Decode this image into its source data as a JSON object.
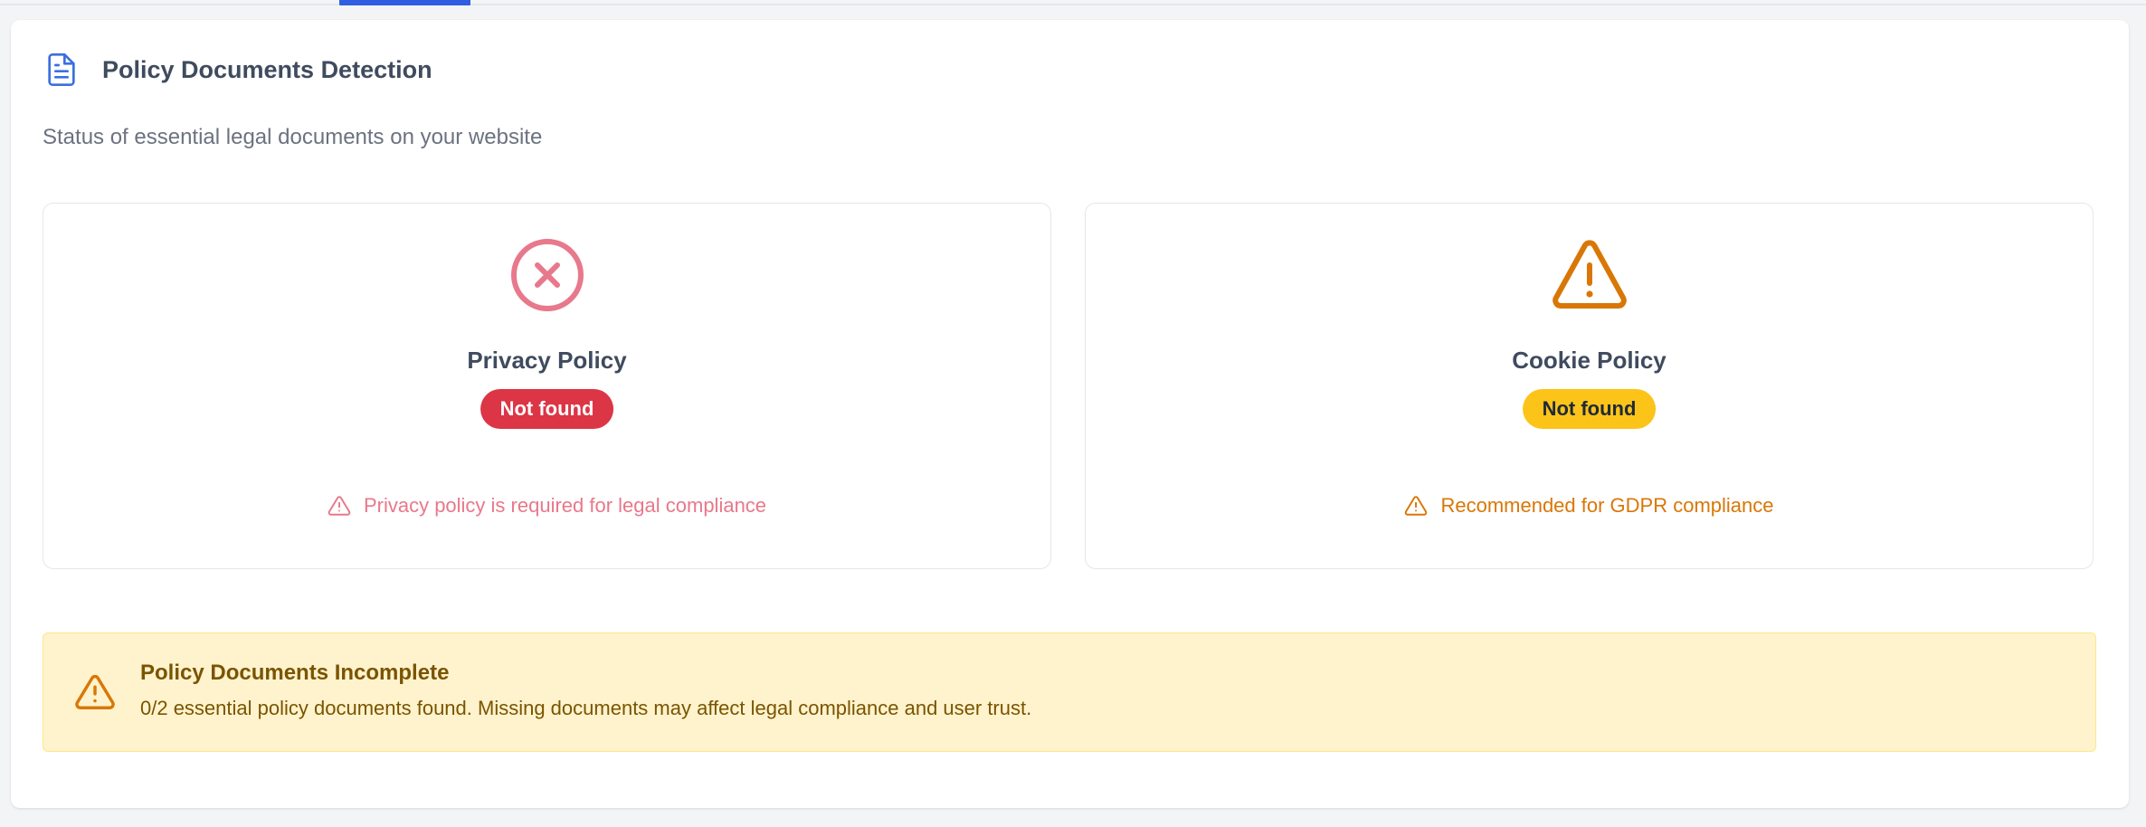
{
  "section": {
    "title": "Policy Documents Detection",
    "subtitle": "Status of essential legal documents on your website"
  },
  "cards": [
    {
      "title": "Privacy Policy",
      "status": "Not found",
      "note": "Privacy policy is required for legal compliance",
      "icon": "x-circle-icon",
      "color": "#dc3545"
    },
    {
      "title": "Cookie Policy",
      "status": "Not found",
      "note": "Recommended for GDPR compliance",
      "icon": "warning-triangle-icon",
      "color": "#d97706"
    }
  ],
  "alert": {
    "title": "Policy Documents Incomplete",
    "text": "0/2 essential policy documents found. Missing documents may affect legal compliance and user trust.",
    "icon": "warning-triangle-icon"
  },
  "colors": {
    "accent": "#2f5fe0",
    "danger": "#dc3545",
    "warning": "#fcc419",
    "warning_text": "#d97706",
    "alert_bg": "#fff3cd"
  }
}
